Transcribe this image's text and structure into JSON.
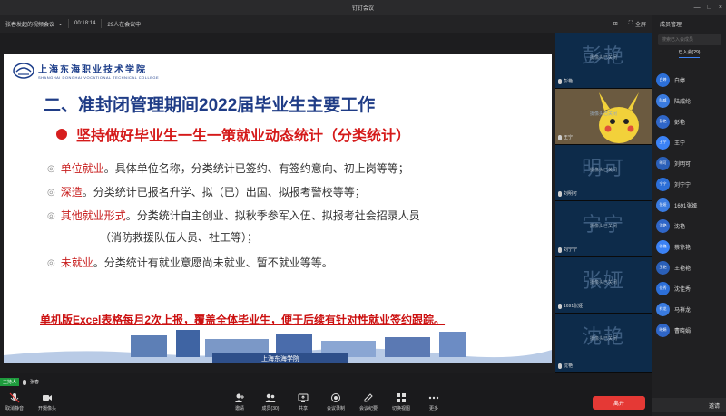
{
  "window": {
    "title": "钉钉会议",
    "controls": [
      "—",
      "□",
      "×"
    ]
  },
  "meeting": {
    "name": "张春发起的视频会议",
    "elapsed": "00:18:14",
    "attendees": "29人在会议中",
    "fullscreen_label": "全屏"
  },
  "slide": {
    "school_cn": "上海东海职业技术学院",
    "school_en": "SHANGHAI DONGHAI VOCATIONAL TECHNICAL COLLEGE",
    "title": "二、准封闭管理期间2022届毕业生主要工作",
    "subtitle": "坚持做好毕业生一生一策就业动态统计（分类统计）",
    "bullets": [
      {
        "kw": "单位就业",
        "text": "。具体单位名称，分类统计已签约、有签约意向、初上岗等等；"
      },
      {
        "kw": "深造",
        "text": "。分类统计已报名升学、拟（已）出国、拟报考警校等等；"
      },
      {
        "kw": "其他就业形式",
        "text": "。分类统计自主创业、拟秋季参军入伍、拟报考社会招录人员"
      },
      {
        "kw": "",
        "text": "（消防救援队伍人员、社工等）；"
      },
      {
        "kw": "未就业",
        "text": "。分类统计有就业意愿尚未就业、暂不就业等等。"
      }
    ],
    "note": "单机版Excel表格每月2次上报，覆盖全体毕业生，便于后续有针对性就业签约跟踪。",
    "campus_sign": "上海东海学院"
  },
  "video_tiles": [
    {
      "watermark": "彭艳",
      "off": "摄像头已关闭",
      "name": "彭艳",
      "type": "blank"
    },
    {
      "watermark": "",
      "off": "摄像头已关闭",
      "name": "王宁",
      "type": "pikachu"
    },
    {
      "watermark": "明可",
      "off": "摄像头已关闭",
      "name": "刘明可",
      "type": "blank"
    },
    {
      "watermark": "宁宁",
      "off": "摄像头已关闭",
      "name": "刘宁宁",
      "type": "blank"
    },
    {
      "watermark": "张娅",
      "off": "摄像头已关闭",
      "name": "1691张娅",
      "type": "blank"
    },
    {
      "watermark": "沈艳",
      "off": "摄像头已关闭",
      "name": "沈艳",
      "type": "blank"
    }
  ],
  "panel": {
    "title": "成员管理",
    "search_placeholder": "搜索已入会成员",
    "tab": "已入会(29)",
    "members": [
      {
        "avatar": "白婷",
        "name": "白婷"
      },
      {
        "avatar": "陆威",
        "name": "陆威纶"
      },
      {
        "avatar": "彭艳",
        "name": "彭艳"
      },
      {
        "avatar": "王宁",
        "name": "王宁"
      },
      {
        "avatar": "明可",
        "name": "刘明可"
      },
      {
        "avatar": "宁宁",
        "name": "刘宁宁"
      },
      {
        "avatar": "张娅",
        "name": "1691张娅"
      },
      {
        "avatar": "沈艳",
        "name": "沈艳"
      },
      {
        "avatar": "徐艳",
        "name": "蔡徐艳"
      },
      {
        "avatar": "王艳",
        "name": "王艳艳"
      },
      {
        "avatar": "佳秀",
        "name": "沈佳秀"
      },
      {
        "avatar": "祥龙",
        "name": "马祥龙"
      },
      {
        "avatar": "晓娟",
        "name": "曹晓娟"
      }
    ],
    "invite_label": "邀请"
  },
  "host": {
    "badge": "主持人",
    "name": "张春"
  },
  "toolbar": {
    "items": [
      {
        "label": "取消静音",
        "icon": "mic-off-icon"
      },
      {
        "label": "开摄像头",
        "icon": "camera-icon"
      },
      {
        "label": "邀请",
        "icon": "invite-icon"
      },
      {
        "label": "成员(30)",
        "icon": "members-icon"
      },
      {
        "label": "共享",
        "icon": "share-icon"
      },
      {
        "label": "会议录制",
        "icon": "record-icon"
      },
      {
        "label": "会议纪要",
        "icon": "notes-icon"
      },
      {
        "label": "切换视图",
        "icon": "view-icon"
      },
      {
        "label": "更多",
        "icon": "more-icon"
      }
    ],
    "leave_label": "离开"
  },
  "colors": {
    "accent": "#3b82f6",
    "leave": "#e53935",
    "host": "#1e9b3d",
    "slide_title": "#1f3c86",
    "slide_red": "#d51a1a"
  }
}
